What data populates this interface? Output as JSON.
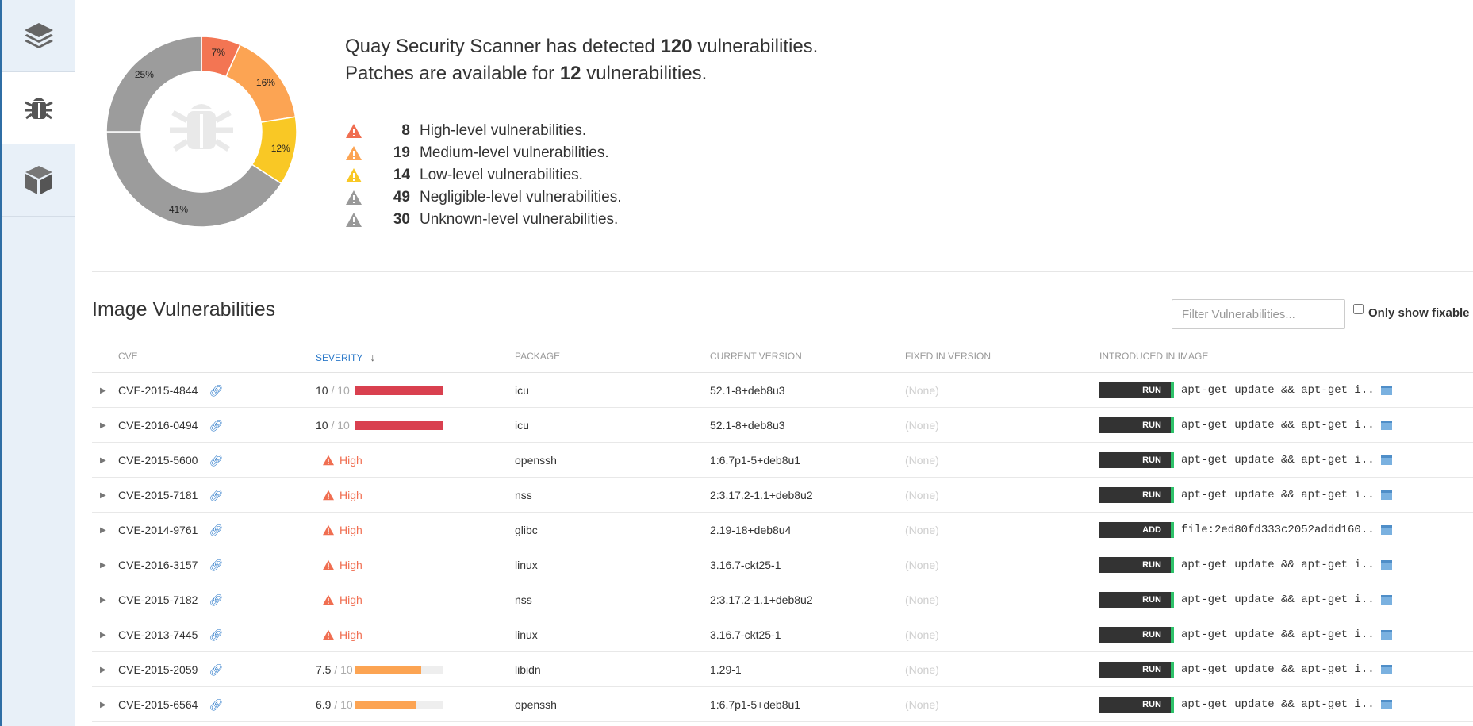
{
  "sidebar": {
    "items": [
      {
        "icon": "layers-icon"
      },
      {
        "icon": "bug-icon",
        "active": true
      },
      {
        "icon": "package-icon"
      }
    ]
  },
  "chart_data": {
    "type": "pie",
    "categories": [
      "High",
      "Medium",
      "Low",
      "Negligible",
      "Unknown"
    ],
    "values": [
      8,
      19,
      14,
      49,
      30
    ],
    "data_labels": [
      "7%",
      "16%",
      "12%",
      "41%",
      "25%"
    ],
    "colors": [
      "#f37553",
      "#fca453",
      "#f9c825",
      "#9c9c9c",
      "#9c9c9c"
    ],
    "center_icon": "bug-icon",
    "title": "",
    "xlabel": "",
    "ylabel": ""
  },
  "summary": {
    "line1_pre": "Quay Security Scanner has detected ",
    "line1_count": "120",
    "line1_post": " vulnerabilities.",
    "line2_pre": "Patches are available for ",
    "line2_count": "12",
    "line2_post": " vulnerabilities."
  },
  "levels": [
    {
      "count": "8",
      "label": "High-level vulnerabilities.",
      "color": "#f06e51"
    },
    {
      "count": "19",
      "label": "Medium-level vulnerabilities.",
      "color": "#fca453"
    },
    {
      "count": "14",
      "label": "Low-level vulnerabilities.",
      "color": "#f9c825"
    },
    {
      "count": "49",
      "label": "Negligible-level vulnerabilities.",
      "color": "#999999"
    },
    {
      "count": "30",
      "label": "Unknown-level vulnerabilities.",
      "color": "#999999"
    }
  ],
  "section": {
    "title": "Image Vulnerabilities",
    "filter_placeholder": "Filter Vulnerabilities...",
    "fixable_label": "Only show fixable"
  },
  "table": {
    "headers": {
      "cve": "CVE",
      "severity": "Severity",
      "package": "Package",
      "current": "Current Version",
      "fixed": "Fixed In Version",
      "introduced": "Introduced In Image"
    },
    "rows": [
      {
        "cve": "CVE-2015-4844",
        "score": "10",
        "max": " / 10",
        "level": 1.0,
        "bar_color": "#d9404f",
        "package": "icu",
        "current": "52.1-8+deb8u3",
        "fixed": "(None)",
        "cmd": "RUN",
        "text": "apt-get update && apt-get i.."
      },
      {
        "cve": "CVE-2016-0494",
        "score": "10",
        "max": " / 10",
        "level": 1.0,
        "bar_color": "#d9404f",
        "package": "icu",
        "current": "52.1-8+deb8u3",
        "fixed": "(None)",
        "cmd": "RUN",
        "text": "apt-get update && apt-get i.."
      },
      {
        "cve": "CVE-2015-5600",
        "high": "High",
        "package": "openssh",
        "current": "1:6.7p1-5+deb8u1",
        "fixed": "(None)",
        "cmd": "RUN",
        "text": "apt-get update && apt-get i.."
      },
      {
        "cve": "CVE-2015-7181",
        "high": "High",
        "package": "nss",
        "current": "2:3.17.2-1.1+deb8u2",
        "fixed": "(None)",
        "cmd": "RUN",
        "text": "apt-get update && apt-get i.."
      },
      {
        "cve": "CVE-2014-9761",
        "high": "High",
        "package": "glibc",
        "current": "2.19-18+deb8u4",
        "fixed": "(None)",
        "cmd": "ADD",
        "text": "file:2ed80fd333c2052addd160.."
      },
      {
        "cve": "CVE-2016-3157",
        "high": "High",
        "package": "linux",
        "current": "3.16.7-ckt25-1",
        "fixed": "(None)",
        "cmd": "RUN",
        "text": "apt-get update && apt-get i.."
      },
      {
        "cve": "CVE-2015-7182",
        "high": "High",
        "package": "nss",
        "current": "2:3.17.2-1.1+deb8u2",
        "fixed": "(None)",
        "cmd": "RUN",
        "text": "apt-get update && apt-get i.."
      },
      {
        "cve": "CVE-2013-7445",
        "high": "High",
        "package": "linux",
        "current": "3.16.7-ckt25-1",
        "fixed": "(None)",
        "cmd": "RUN",
        "text": "apt-get update && apt-get i.."
      },
      {
        "cve": "CVE-2015-2059",
        "score": "7.5",
        "max": " / 10",
        "level": 0.75,
        "bar_color": "#fca453",
        "package": "libidn",
        "current": "1.29-1",
        "fixed": "(None)",
        "cmd": "RUN",
        "text": "apt-get update && apt-get i.."
      },
      {
        "cve": "CVE-2015-6564",
        "score": "6.9",
        "max": " / 10",
        "level": 0.69,
        "bar_color": "#fca453",
        "package": "openssh",
        "current": "1:6.7p1-5+deb8u1",
        "fixed": "(None)",
        "cmd": "RUN",
        "text": "apt-get update && apt-get i.."
      }
    ]
  }
}
